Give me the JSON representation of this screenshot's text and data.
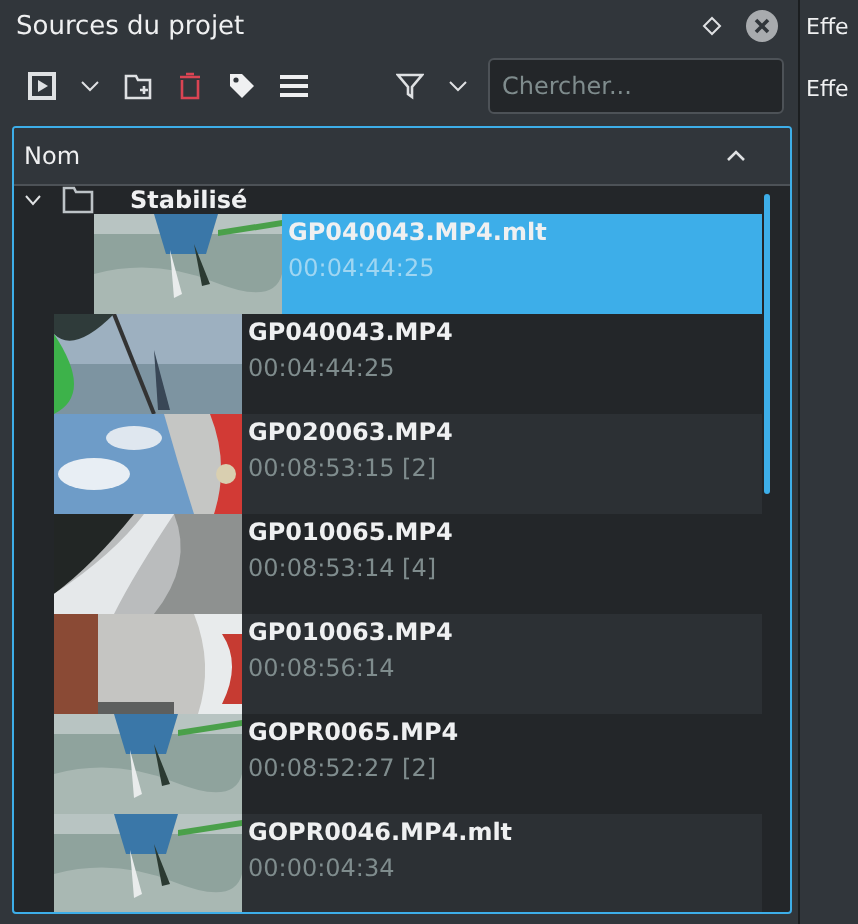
{
  "panel": {
    "title": "Sources du projet"
  },
  "toolbar": {
    "search": {
      "placeholder": "Chercher..."
    }
  },
  "tree": {
    "column": "Nom",
    "items": [
      {
        "kind": "folder",
        "name": "Stabilisé",
        "expanded": true,
        "children": [
          {
            "kind": "clip",
            "name": "GP040043.MP4.mlt",
            "duration": "00:04:44:25",
            "selected": true
          }
        ]
      },
      {
        "kind": "clip",
        "name": "GP040043.MP4",
        "duration": "00:04:44:25",
        "selected": false
      },
      {
        "kind": "clip",
        "name": "GP020063.MP4",
        "duration": "00:08:53:15 [2]",
        "selected": false
      },
      {
        "kind": "clip",
        "name": "GP010065.MP4",
        "duration": "00:08:53:14 [4]",
        "selected": false
      },
      {
        "kind": "clip",
        "name": "GP010063.MP4",
        "duration": "00:08:56:14",
        "selected": false
      },
      {
        "kind": "clip",
        "name": "GOPR0065.MP4",
        "duration": "00:08:52:27 [2]",
        "selected": false
      },
      {
        "kind": "clip",
        "name": "GOPR0046.MP4.mlt",
        "duration": "00:00:04:34",
        "selected": false
      }
    ]
  },
  "side_panel": {
    "title": "Effe",
    "tab": "Effe"
  }
}
